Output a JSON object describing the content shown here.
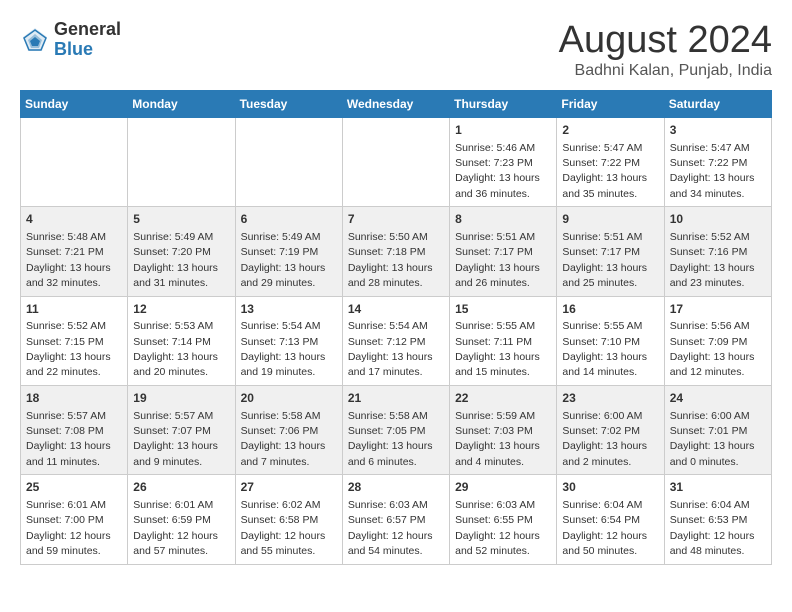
{
  "header": {
    "logo_general": "General",
    "logo_blue": "Blue",
    "month_title": "August 2024",
    "subtitle": "Badhni Kalan, Punjab, India"
  },
  "days_of_week": [
    "Sunday",
    "Monday",
    "Tuesday",
    "Wednesday",
    "Thursday",
    "Friday",
    "Saturday"
  ],
  "weeks": [
    [
      {
        "day": "",
        "info": ""
      },
      {
        "day": "",
        "info": ""
      },
      {
        "day": "",
        "info": ""
      },
      {
        "day": "",
        "info": ""
      },
      {
        "day": "1",
        "info": "Sunrise: 5:46 AM\nSunset: 7:23 PM\nDaylight: 13 hours\nand 36 minutes."
      },
      {
        "day": "2",
        "info": "Sunrise: 5:47 AM\nSunset: 7:22 PM\nDaylight: 13 hours\nand 35 minutes."
      },
      {
        "day": "3",
        "info": "Sunrise: 5:47 AM\nSunset: 7:22 PM\nDaylight: 13 hours\nand 34 minutes."
      }
    ],
    [
      {
        "day": "4",
        "info": "Sunrise: 5:48 AM\nSunset: 7:21 PM\nDaylight: 13 hours\nand 32 minutes."
      },
      {
        "day": "5",
        "info": "Sunrise: 5:49 AM\nSunset: 7:20 PM\nDaylight: 13 hours\nand 31 minutes."
      },
      {
        "day": "6",
        "info": "Sunrise: 5:49 AM\nSunset: 7:19 PM\nDaylight: 13 hours\nand 29 minutes."
      },
      {
        "day": "7",
        "info": "Sunrise: 5:50 AM\nSunset: 7:18 PM\nDaylight: 13 hours\nand 28 minutes."
      },
      {
        "day": "8",
        "info": "Sunrise: 5:51 AM\nSunset: 7:17 PM\nDaylight: 13 hours\nand 26 minutes."
      },
      {
        "day": "9",
        "info": "Sunrise: 5:51 AM\nSunset: 7:17 PM\nDaylight: 13 hours\nand 25 minutes."
      },
      {
        "day": "10",
        "info": "Sunrise: 5:52 AM\nSunset: 7:16 PM\nDaylight: 13 hours\nand 23 minutes."
      }
    ],
    [
      {
        "day": "11",
        "info": "Sunrise: 5:52 AM\nSunset: 7:15 PM\nDaylight: 13 hours\nand 22 minutes."
      },
      {
        "day": "12",
        "info": "Sunrise: 5:53 AM\nSunset: 7:14 PM\nDaylight: 13 hours\nand 20 minutes."
      },
      {
        "day": "13",
        "info": "Sunrise: 5:54 AM\nSunset: 7:13 PM\nDaylight: 13 hours\nand 19 minutes."
      },
      {
        "day": "14",
        "info": "Sunrise: 5:54 AM\nSunset: 7:12 PM\nDaylight: 13 hours\nand 17 minutes."
      },
      {
        "day": "15",
        "info": "Sunrise: 5:55 AM\nSunset: 7:11 PM\nDaylight: 13 hours\nand 15 minutes."
      },
      {
        "day": "16",
        "info": "Sunrise: 5:55 AM\nSunset: 7:10 PM\nDaylight: 13 hours\nand 14 minutes."
      },
      {
        "day": "17",
        "info": "Sunrise: 5:56 AM\nSunset: 7:09 PM\nDaylight: 13 hours\nand 12 minutes."
      }
    ],
    [
      {
        "day": "18",
        "info": "Sunrise: 5:57 AM\nSunset: 7:08 PM\nDaylight: 13 hours\nand 11 minutes."
      },
      {
        "day": "19",
        "info": "Sunrise: 5:57 AM\nSunset: 7:07 PM\nDaylight: 13 hours\nand 9 minutes."
      },
      {
        "day": "20",
        "info": "Sunrise: 5:58 AM\nSunset: 7:06 PM\nDaylight: 13 hours\nand 7 minutes."
      },
      {
        "day": "21",
        "info": "Sunrise: 5:58 AM\nSunset: 7:05 PM\nDaylight: 13 hours\nand 6 minutes."
      },
      {
        "day": "22",
        "info": "Sunrise: 5:59 AM\nSunset: 7:03 PM\nDaylight: 13 hours\nand 4 minutes."
      },
      {
        "day": "23",
        "info": "Sunrise: 6:00 AM\nSunset: 7:02 PM\nDaylight: 13 hours\nand 2 minutes."
      },
      {
        "day": "24",
        "info": "Sunrise: 6:00 AM\nSunset: 7:01 PM\nDaylight: 13 hours\nand 0 minutes."
      }
    ],
    [
      {
        "day": "25",
        "info": "Sunrise: 6:01 AM\nSunset: 7:00 PM\nDaylight: 12 hours\nand 59 minutes."
      },
      {
        "day": "26",
        "info": "Sunrise: 6:01 AM\nSunset: 6:59 PM\nDaylight: 12 hours\nand 57 minutes."
      },
      {
        "day": "27",
        "info": "Sunrise: 6:02 AM\nSunset: 6:58 PM\nDaylight: 12 hours\nand 55 minutes."
      },
      {
        "day": "28",
        "info": "Sunrise: 6:03 AM\nSunset: 6:57 PM\nDaylight: 12 hours\nand 54 minutes."
      },
      {
        "day": "29",
        "info": "Sunrise: 6:03 AM\nSunset: 6:55 PM\nDaylight: 12 hours\nand 52 minutes."
      },
      {
        "day": "30",
        "info": "Sunrise: 6:04 AM\nSunset: 6:54 PM\nDaylight: 12 hours\nand 50 minutes."
      },
      {
        "day": "31",
        "info": "Sunrise: 6:04 AM\nSunset: 6:53 PM\nDaylight: 12 hours\nand 48 minutes."
      }
    ]
  ]
}
